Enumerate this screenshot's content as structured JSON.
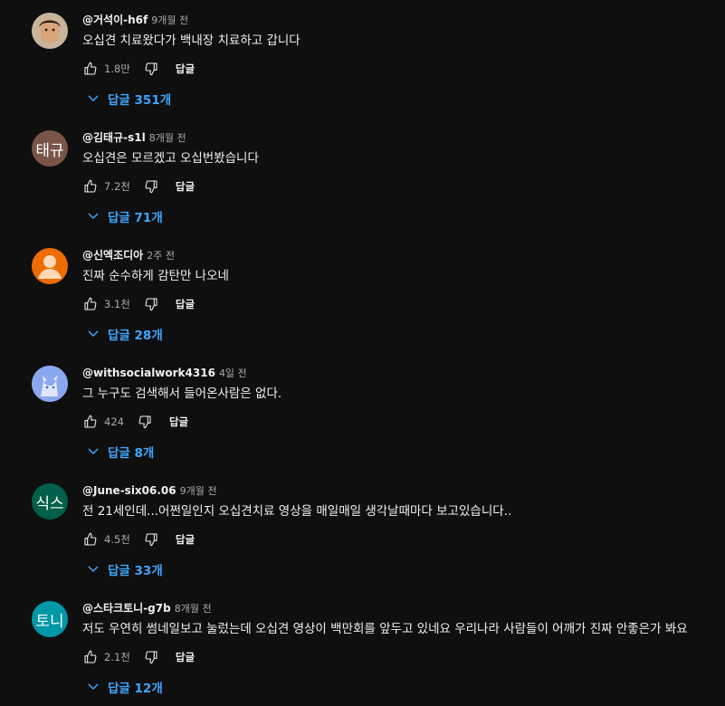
{
  "labels": {
    "reply": "답글"
  },
  "colors": {
    "background": "#0f0f0f",
    "text": "#f1f1f1",
    "muted": "#aaaaaa",
    "link": "#3ea6ff"
  },
  "comments": [
    {
      "author": "@거석이-h6f",
      "time": "9개월 전",
      "text": "오십견 치료왔다가 백내장 치료하고 갑니다",
      "likes": "1.8만",
      "replies_label": "답글 351개",
      "avatar": {
        "type": "photo",
        "icon": "person-photo",
        "bg": "#5a4a3a",
        "initials": ""
      }
    },
    {
      "author": "@김태규-s1l",
      "time": "8개월 전",
      "text": "오십견은 모르겠고 오십번봤습니다",
      "likes": "7.2천",
      "replies_label": "답글 71개",
      "avatar": {
        "type": "initials",
        "icon": "initials-avatar",
        "bg": "#795548",
        "initials": "태규"
      }
    },
    {
      "author": "@신엑조디아",
      "time": "2주 전",
      "text": "진짜 순수하게 감탄만 나오네",
      "likes": "3.1천",
      "replies_label": "답글 28개",
      "avatar": {
        "type": "default",
        "icon": "default-user-icon",
        "bg": "#ef6c00",
        "initials": ""
      }
    },
    {
      "author": "@withsocialwork4316",
      "time": "4일 전",
      "text": "그 누구도 검색해서 들어온사람은 없다.",
      "likes": "424",
      "replies_label": "답글 8개",
      "avatar": {
        "type": "illustration",
        "icon": "cat-illustration",
        "bg": "#7b9be0",
        "initials": ""
      }
    },
    {
      "author": "@June-six06.06",
      "time": "9개월 전",
      "text": "전 21세인데...어쩐일인지 오십견치료 영상을 매일매일 생각날때마다 보고있습니다..",
      "likes": "4.5천",
      "replies_label": "답글 33개",
      "avatar": {
        "type": "initials",
        "icon": "initials-avatar",
        "bg": "#00604b",
        "initials": "식스"
      }
    },
    {
      "author": "@스타크토니-g7b",
      "time": "8개월 전",
      "text": "저도 우연히 썸네일보고 눌렀는데 오십견 영상이 백만회를 앞두고 있네요 우리나라 사람들이 어깨가 진짜 안좋은가 봐요",
      "likes": "2.1천",
      "replies_label": "답글 12개",
      "avatar": {
        "type": "initials",
        "icon": "initials-avatar",
        "bg": "#0097a7",
        "initials": "토니"
      }
    }
  ]
}
